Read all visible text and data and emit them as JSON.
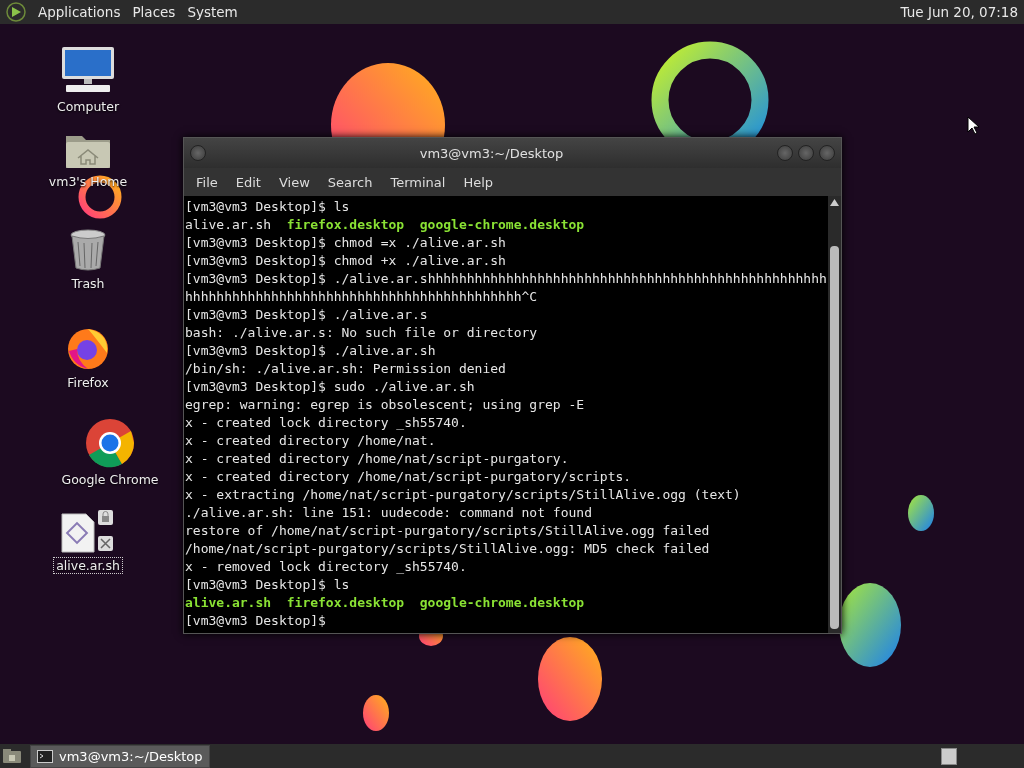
{
  "top_panel": {
    "menus": [
      "Applications",
      "Places",
      "System"
    ],
    "clock": "Tue Jun 20, 07:18"
  },
  "desktop_icons": [
    {
      "label": "Computer",
      "kind": "computer",
      "selected": false
    },
    {
      "label": "vm3's Home",
      "kind": "home",
      "selected": false
    },
    {
      "label": "Trash",
      "kind": "trash",
      "selected": false
    },
    {
      "label": "Firefox",
      "kind": "firefox",
      "selected": false
    },
    {
      "label": "Google Chrome",
      "kind": "chrome",
      "selected": false
    },
    {
      "label": "alive.ar.sh",
      "kind": "script",
      "selected": true
    }
  ],
  "terminal": {
    "title": "vm3@vm3:~/Desktop",
    "menu": [
      "File",
      "Edit",
      "View",
      "Search",
      "Terminal",
      "Help"
    ],
    "lines": [
      [
        {
          "text": "[vm3@vm3 Desktop]$ ls",
          "kind": "plain"
        }
      ],
      [
        {
          "text": "alive.ar.sh",
          "kind": "plain"
        },
        {
          "text": "firefox.desktop",
          "kind": "exec"
        },
        {
          "text": "google-chrome.desktop",
          "kind": "exec"
        }
      ],
      [
        {
          "text": "[vm3@vm3 Desktop]$ chmod =x ./alive.ar.sh",
          "kind": "plain"
        }
      ],
      [
        {
          "text": "[vm3@vm3 Desktop]$ chmod +x ./alive.ar.sh",
          "kind": "plain"
        }
      ],
      [
        {
          "text": "[vm3@vm3 Desktop]$ ./alive.ar.shhhhhhhhhhhhhhhhhhhhhhhhhhhhhhhhhhhhhhhhhhhhhhhhhhh",
          "kind": "plain"
        }
      ],
      [
        {
          "text": "hhhhhhhhhhhhhhhhhhhhhhhhhhhhhhhhhhhhhhhhhhh^C",
          "kind": "plain"
        }
      ],
      [
        {
          "text": "[vm3@vm3 Desktop]$ ./alive.ar.s",
          "kind": "plain"
        }
      ],
      [
        {
          "text": "bash: ./alive.ar.s: No such file or directory",
          "kind": "plain"
        }
      ],
      [
        {
          "text": "[vm3@vm3 Desktop]$ ./alive.ar.sh",
          "kind": "plain"
        }
      ],
      [
        {
          "text": "/bin/sh: ./alive.ar.sh: Permission denied",
          "kind": "plain"
        }
      ],
      [
        {
          "text": "[vm3@vm3 Desktop]$ sudo ./alive.ar.sh",
          "kind": "plain"
        }
      ],
      [
        {
          "text": "egrep: warning: egrep is obsolescent; using grep -E",
          "kind": "plain"
        }
      ],
      [
        {
          "text": "x - created lock directory _sh55740.",
          "kind": "plain"
        }
      ],
      [
        {
          "text": "x - created directory /home/nat.",
          "kind": "plain"
        }
      ],
      [
        {
          "text": "x - created directory /home/nat/script-purgatory.",
          "kind": "plain"
        }
      ],
      [
        {
          "text": "x - created directory /home/nat/script-purgatory/scripts.",
          "kind": "plain"
        }
      ],
      [
        {
          "text": "x - extracting /home/nat/script-purgatory/scripts/StillAlive.ogg (text)",
          "kind": "plain"
        }
      ],
      [
        {
          "text": "./alive.ar.sh: line 151: uudecode: command not found",
          "kind": "plain"
        }
      ],
      [
        {
          "text": "restore of /home/nat/script-purgatory/scripts/StillAlive.ogg failed",
          "kind": "plain"
        }
      ],
      [
        {
          "text": "/home/nat/script-purgatory/scripts/StillAlive.ogg: MD5 check failed",
          "kind": "plain"
        }
      ],
      [
        {
          "text": "x - removed lock directory _sh55740.",
          "kind": "plain"
        }
      ],
      [
        {
          "text": "[vm3@vm3 Desktop]$ ls",
          "kind": "plain"
        }
      ],
      [
        {
          "text": "alive.ar.sh",
          "kind": "exec"
        },
        {
          "text": "firefox.desktop",
          "kind": "exec"
        },
        {
          "text": "google-chrome.desktop",
          "kind": "exec"
        }
      ],
      [
        {
          "text": "[vm3@vm3 Desktop]$",
          "kind": "plain"
        }
      ]
    ]
  },
  "taskbar": {
    "tasks": [
      {
        "label": "vm3@vm3:~/Desktop",
        "selected": true
      }
    ]
  }
}
